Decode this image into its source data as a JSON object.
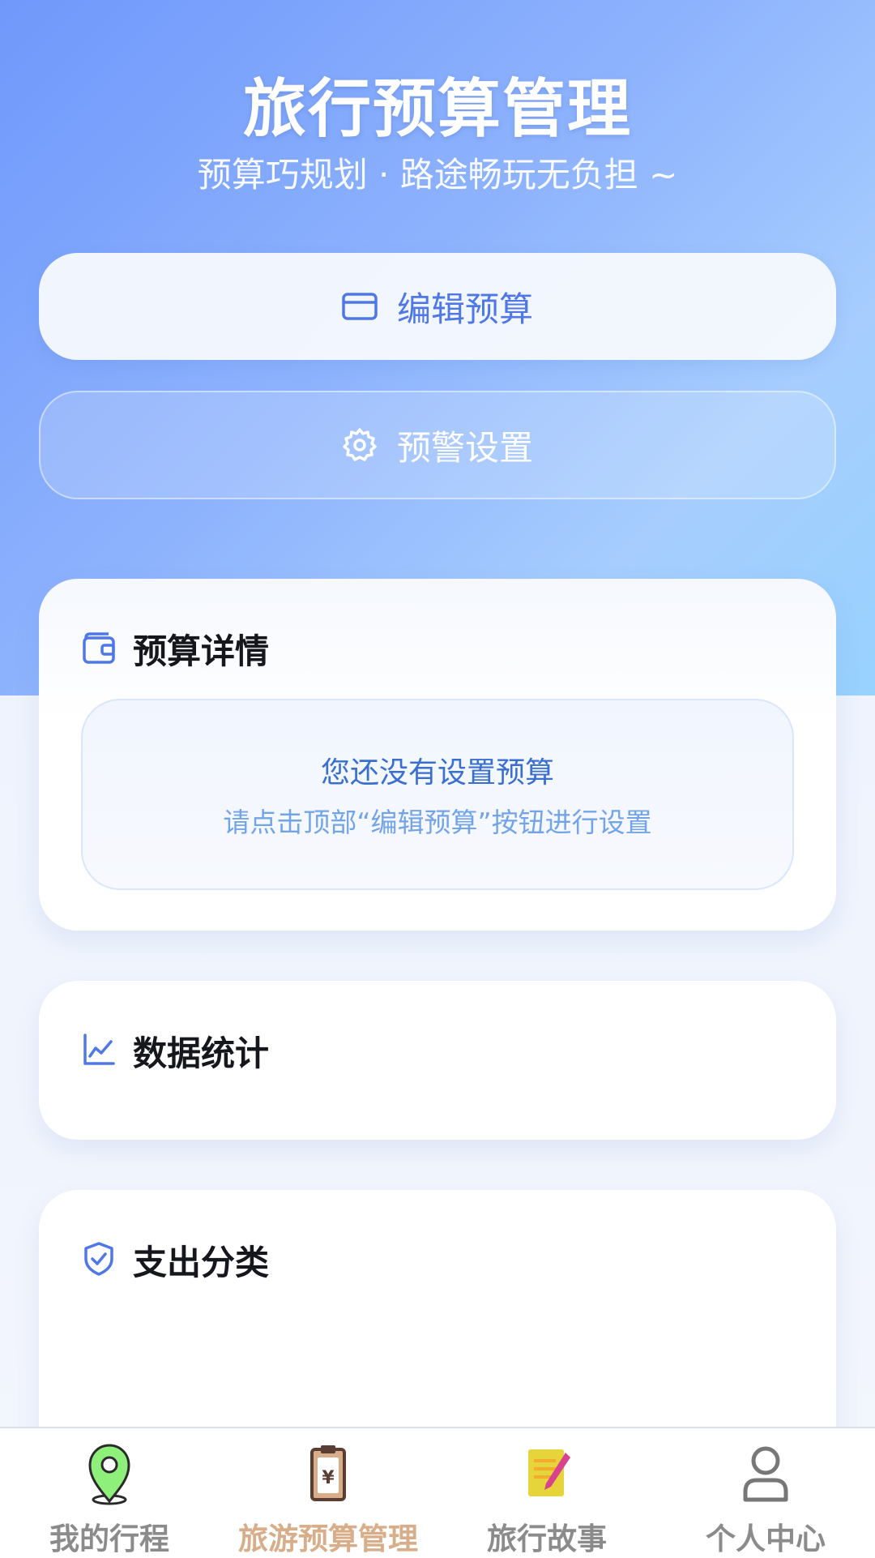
{
  "header": {
    "title": "旅行预算管理",
    "subtitle": "预算巧规划 · 路途畅玩无负担 ~"
  },
  "actions": {
    "edit_label": "编辑预算",
    "alert_label": "预警设置"
  },
  "cards": {
    "budget": {
      "title": "预算详情",
      "empty_title": "您还没有设置预算",
      "empty_hint": "请点击顶部“编辑预算”按钮进行设置"
    },
    "stats": {
      "title": "数据统计"
    },
    "category": {
      "title": "支出分类"
    }
  },
  "tabbar": {
    "items": [
      {
        "label": "我的行程",
        "icon": "map-pin-icon"
      },
      {
        "label": "旅游预算管理",
        "icon": "clipboard-budget-icon",
        "active": true
      },
      {
        "label": "旅行故事",
        "icon": "notebook-pen-icon"
      },
      {
        "label": "个人中心",
        "icon": "user-icon"
      }
    ]
  },
  "colors": {
    "accent": "#4f78e6",
    "tab_active": "#d8ae8a",
    "tab_inactive": "#8b8b8b"
  }
}
